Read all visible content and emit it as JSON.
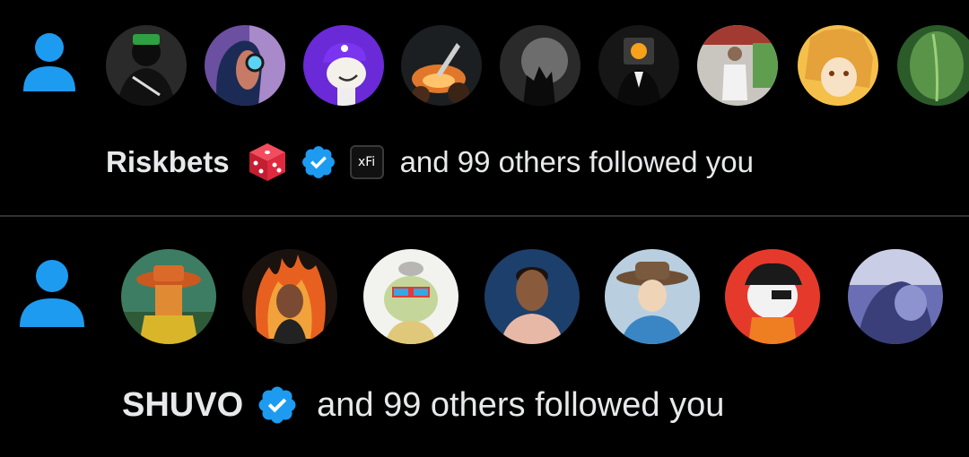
{
  "notifications": [
    {
      "icon": "person-icon",
      "avatars": [
        "masked-figure-avatar",
        "goggles-woman-avatar",
        "purple-cap-character-avatar",
        "rocket-launch-avatar",
        "dark-creature-avatar",
        "bitcoin-tv-head-avatar",
        "man-in-office-avatar",
        "anime-blonde-avatar",
        "green-leaf-avatar"
      ],
      "name": "Riskbets",
      "badges": [
        "dice-icon",
        "verified-badge-icon",
        "xfi-badge"
      ],
      "xfi_label": "xFi",
      "rest": "and 99 others followed you"
    },
    {
      "icon": "person-icon",
      "avatars": [
        "orange-hat-character-avatar",
        "fire-woman-avatar",
        "ape-nft-avatar",
        "young-man-portrait-avatar",
        "cowboy-hat-man-avatar",
        "pirate-cat-avatar",
        "blurred-figure-avatar"
      ],
      "name": "SHUVO",
      "badges": [
        "verified-badge-icon"
      ],
      "rest": "and 99 others followed you"
    }
  ],
  "colors": {
    "background": "#000000",
    "text": "#e7e9ea",
    "icon_blue": "#1d9bf0",
    "divider": "#2f3336"
  }
}
